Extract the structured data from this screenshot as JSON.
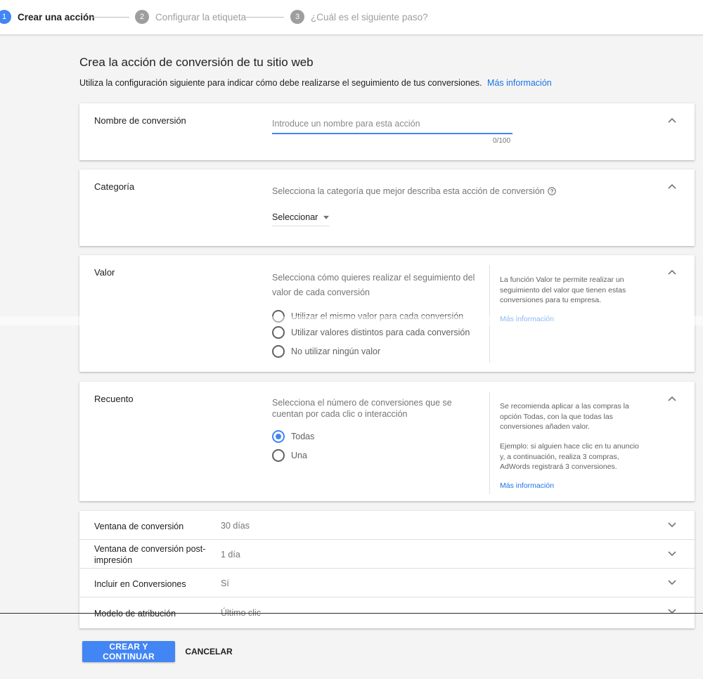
{
  "stepper": {
    "steps": [
      {
        "number": "1",
        "label": "Crear una acción"
      },
      {
        "number": "2",
        "label": "Configurar la etiqueta"
      },
      {
        "number": "3",
        "label": "¿Cuál es el siguiente paso?"
      }
    ]
  },
  "header": {
    "title": "Crea la acción de conversión de tu sitio web",
    "description": "Utiliza la configuración siguiente para indicar cómo debe realizarse el seguimiento de tus conversiones.",
    "more_info": "Más información"
  },
  "name_card": {
    "label": "Nombre de conversión",
    "placeholder": "Introduce un nombre para esta acción",
    "value": "",
    "counter": "0/100"
  },
  "category_card": {
    "label": "Categoría",
    "hint": "Selecciona la categoría que mejor describa esta acción de conversión",
    "select_value": "Seleccionar"
  },
  "value_card": {
    "label": "Valor",
    "hint": "Selecciona cómo quieres realizar el seguimiento del valor de cada conversión",
    "options": [
      "Utilizar el mismo valor para cada conversión",
      "Utilizar valores distintos para cada conversión",
      "No utilizar ningún valor"
    ],
    "side_text": "La función Valor te permite realizar un seguimiento del valor que tienen estas conversiones para tu empresa.",
    "side_link": "Más información"
  },
  "count_card": {
    "label": "Recuento",
    "hint": "Selecciona el número de conversiones que se cuentan por cada clic o interacción",
    "options": [
      "Todas",
      "Una"
    ],
    "selected": "Todas",
    "side_text_1": "Se recomienda aplicar a las compras la opción Todas, con la que todas las conversiones añaden valor.",
    "side_text_2": "Ejemplo: si alguien hace clic en tu anuncio y, a continuación, realiza 3 compras, AdWords registrará 3 conversiones.",
    "side_link": "Más información"
  },
  "settings": [
    {
      "label": "Ventana de conversión",
      "value": "30 días"
    },
    {
      "label": "Ventana de conversión post-impresión",
      "value": "1 día"
    },
    {
      "label": "Incluir en Conversiones",
      "value": "Sí"
    },
    {
      "label": "Modelo de atribución",
      "value": "Último clic"
    }
  ],
  "footer": {
    "primary_button": "CREAR Y CONTINUAR",
    "cancel_button": "CANCELAR"
  },
  "colors": {
    "accent": "#4285f4",
    "link": "#1a73e8",
    "inactive": "#9e9e9e"
  }
}
